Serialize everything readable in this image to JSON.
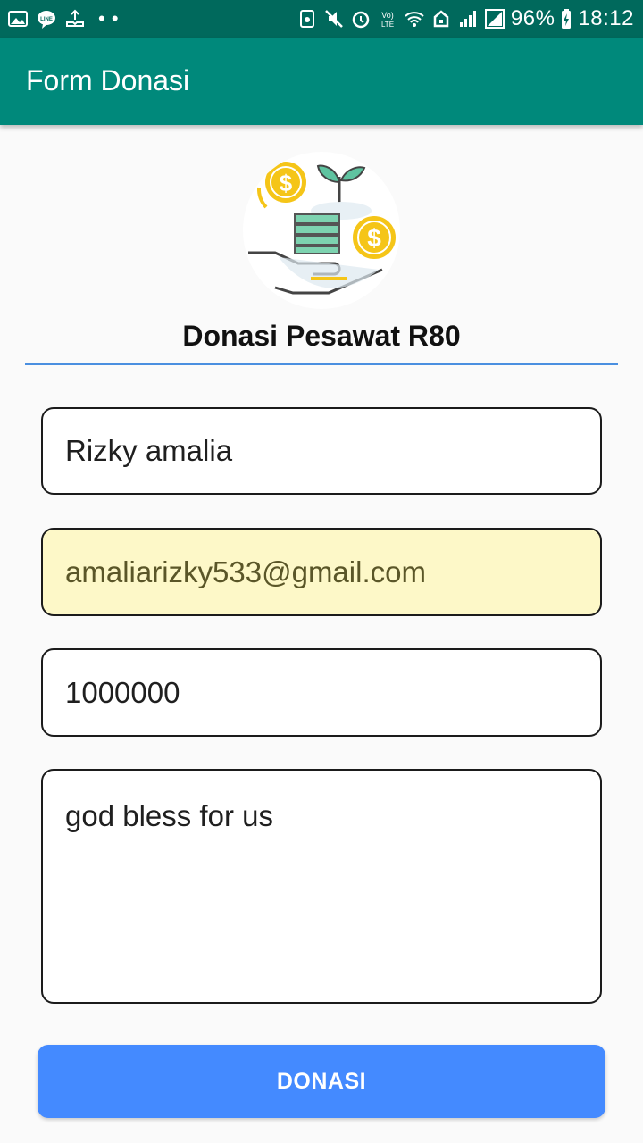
{
  "status_bar": {
    "battery": "96%",
    "time": "18:12",
    "left_icons": [
      "gallery-icon",
      "line-icon",
      "upload-icon"
    ],
    "right_icons": [
      "recycle-icon",
      "mute-icon",
      "alarm-icon",
      "volte-icon",
      "wifi-icon",
      "nfc-icon",
      "signal-icon",
      "signal-icon",
      "battery-icon"
    ]
  },
  "app_bar": {
    "title": "Form Donasi"
  },
  "header": {
    "title": "Donasi Pesawat R80",
    "logo": "donation-hand-coins-icon"
  },
  "form": {
    "name": "Rizky amalia",
    "email": "amaliarizky533@gmail.com",
    "amount": "1000000",
    "message": "god bless for us"
  },
  "button": {
    "label": "DONASI"
  },
  "colors": {
    "status_bar": "#00695c",
    "app_bar": "#00897b",
    "button": "#448aff",
    "divider": "#4a8fe0",
    "autofill": "#fdf8c8"
  }
}
